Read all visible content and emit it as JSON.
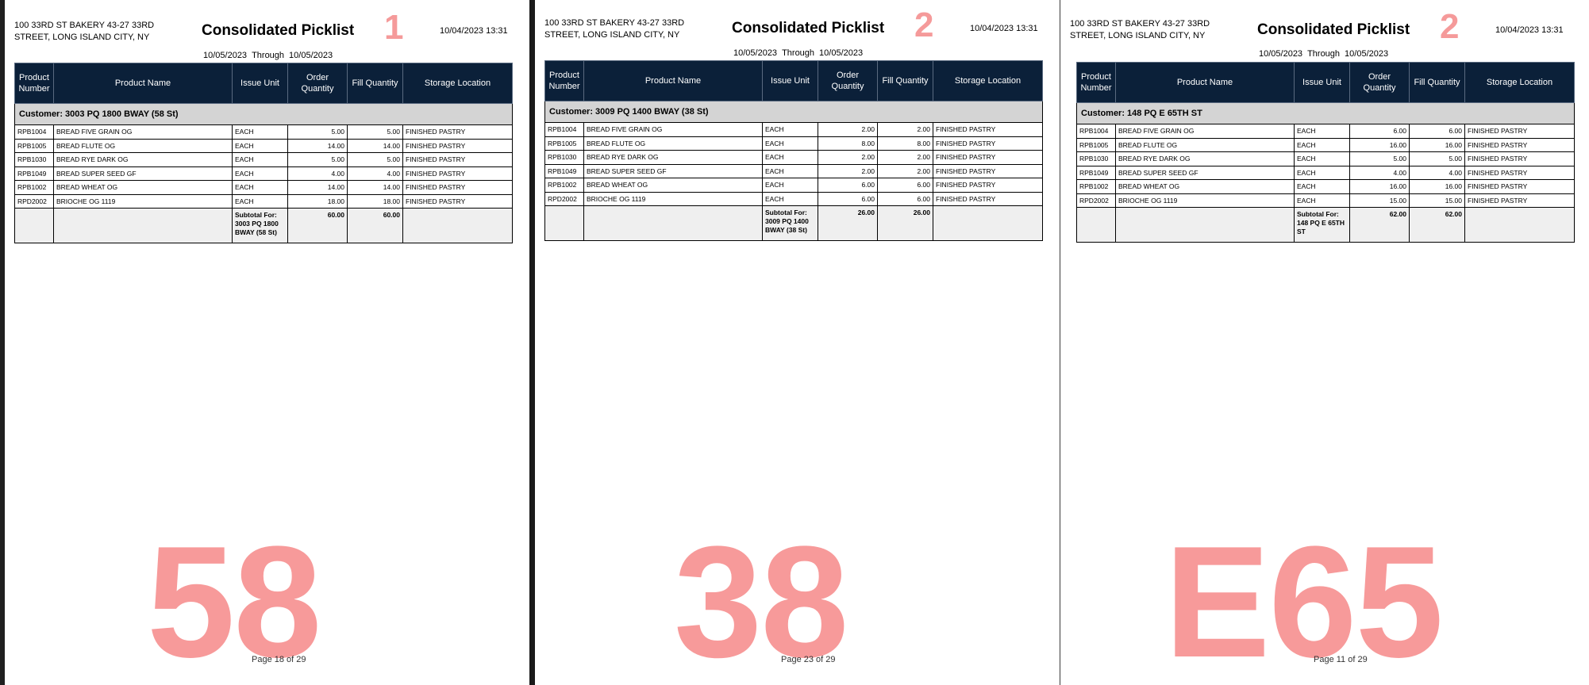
{
  "pages": [
    {
      "company": "100 33RD ST BAKERY 43-27 33RD STREET, LONG ISLAND CITY, NY",
      "title": "Consolidated Picklist",
      "route": "1",
      "print_date": "10/04/2023 13:31",
      "date_from": "10/05/2023",
      "through": "Through",
      "date_to": "10/05/2023",
      "headers": [
        "Product Number",
        "Product Name",
        "Issue Unit",
        "Order Quantity",
        "Fill Quantity",
        "Storage Location"
      ],
      "customer": "Customer: 3003 PQ 1800 BWAY (58 St)",
      "rows": [
        [
          "RPB1004",
          "BREAD FIVE GRAIN OG",
          "EACH",
          "5.00",
          "5.00",
          "FINISHED PASTRY"
        ],
        [
          "RPB1005",
          "BREAD FLUTE OG",
          "EACH",
          "14.00",
          "14.00",
          "FINISHED PASTRY"
        ],
        [
          "RPB1030",
          "BREAD RYE DARK OG",
          "EACH",
          "5.00",
          "5.00",
          "FINISHED PASTRY"
        ],
        [
          "RPB1049",
          "BREAD SUPER SEED GF",
          "EACH",
          "4.00",
          "4.00",
          "FINISHED PASTRY"
        ],
        [
          "RPB1002",
          "BREAD WHEAT OG",
          "EACH",
          "14.00",
          "14.00",
          "FINISHED PASTRY"
        ],
        [
          "RPD2002",
          "BRIOCHE OG 1119",
          "EACH",
          "18.00",
          "18.00",
          "FINISHED PASTRY"
        ]
      ],
      "subtotal_label": "Subtotal For: 3003 PQ 1800 BWAY (58 St)",
      "subtotal_order": "60.00",
      "subtotal_fill": "60.00",
      "watermark": "58",
      "page_text": "Page 18 of  29"
    },
    {
      "company": "100 33RD ST BAKERY 43-27 33RD STREET, LONG ISLAND CITY, NY",
      "title": "Consolidated Picklist",
      "route": "2",
      "print_date": "10/04/2023 13:31",
      "date_from": "10/05/2023",
      "through": "Through",
      "date_to": "10/05/2023",
      "headers": [
        "Product Number",
        "Product Name",
        "Issue Unit",
        "Order Quantity",
        "Fill Quantity",
        "Storage Location"
      ],
      "customer": "Customer: 3009 PQ 1400 BWAY (38 St)",
      "rows": [
        [
          "RPB1004",
          "BREAD FIVE GRAIN OG",
          "EACH",
          "2.00",
          "2.00",
          "FINISHED PASTRY"
        ],
        [
          "RPB1005",
          "BREAD FLUTE OG",
          "EACH",
          "8.00",
          "8.00",
          "FINISHED PASTRY"
        ],
        [
          "RPB1030",
          "BREAD RYE DARK OG",
          "EACH",
          "2.00",
          "2.00",
          "FINISHED PASTRY"
        ],
        [
          "RPB1049",
          "BREAD SUPER SEED GF",
          "EACH",
          "2.00",
          "2.00",
          "FINISHED PASTRY"
        ],
        [
          "RPB1002",
          "BREAD WHEAT OG",
          "EACH",
          "6.00",
          "6.00",
          "FINISHED PASTRY"
        ],
        [
          "RPD2002",
          "BRIOCHE OG 1119",
          "EACH",
          "6.00",
          "6.00",
          "FINISHED PASTRY"
        ]
      ],
      "subtotal_label": "Subtotal For: 3009 PQ 1400 BWAY (38 St)",
      "subtotal_order": "26.00",
      "subtotal_fill": "26.00",
      "watermark": "38",
      "page_text": "Page 23 of  29"
    },
    {
      "company": "100 33RD ST BAKERY 43-27 33RD STREET, LONG ISLAND CITY, NY",
      "title": "Consolidated Picklist",
      "route": "2",
      "print_date": "10/04/2023 13:31",
      "date_from": "10/05/2023",
      "through": "Through",
      "date_to": "10/05/2023",
      "headers": [
        "Product Number",
        "Product Name",
        "Issue Unit",
        "Order Quantity",
        "Fill Quantity",
        "Storage Location"
      ],
      "customer": "Customer: 148 PQ E 65TH ST",
      "rows": [
        [
          "RPB1004",
          "BREAD FIVE GRAIN OG",
          "EACH",
          "6.00",
          "6.00",
          "FINISHED PASTRY"
        ],
        [
          "RPB1005",
          "BREAD FLUTE OG",
          "EACH",
          "16.00",
          "16.00",
          "FINISHED PASTRY"
        ],
        [
          "RPB1030",
          "BREAD RYE DARK OG",
          "EACH",
          "5.00",
          "5.00",
          "FINISHED PASTRY"
        ],
        [
          "RPB1049",
          "BREAD SUPER SEED GF",
          "EACH",
          "4.00",
          "4.00",
          "FINISHED PASTRY"
        ],
        [
          "RPB1002",
          "BREAD WHEAT OG",
          "EACH",
          "16.00",
          "16.00",
          "FINISHED PASTRY"
        ],
        [
          "RPD2002",
          "BRIOCHE OG 1119",
          "EACH",
          "15.00",
          "15.00",
          "FINISHED PASTRY"
        ]
      ],
      "subtotal_label": "Subtotal For: 148 PQ E 65TH ST",
      "subtotal_order": "62.00",
      "subtotal_fill": "62.00",
      "watermark": "E65",
      "page_text": "Page 11 of  29"
    }
  ]
}
